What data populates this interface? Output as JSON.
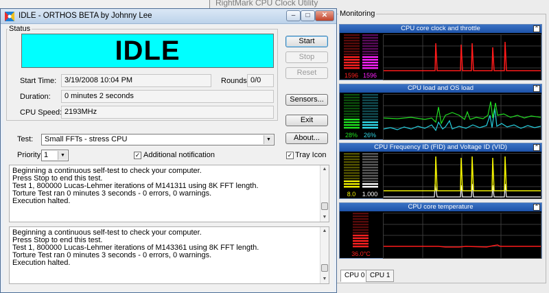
{
  "rightmark": {
    "title": "RightMark CPU Clock Utility",
    "monitoring_label": "Monitoring",
    "collapse_glyph": "⌃",
    "panels": [
      {
        "title": "CPU core clock and throttle",
        "readout_left": "1596",
        "readout_right": "1596",
        "color_left": "#ff2020",
        "color_right": "#ff20ff",
        "graph_color": "#ff1a1a",
        "level_left": 0.35,
        "level_right": 0.35
      },
      {
        "title": "CPU load and OS load",
        "readout_left": "28%",
        "readout_right": "26%",
        "color_left": "#20e020",
        "color_right": "#30d8e8",
        "graph_color": "#22dd22",
        "graph_color_2": "#26d0e0",
        "level_left": 0.28,
        "level_right": 0.26
      },
      {
        "title": "CPU Frequency ID (FID) and Voltage ID (VID)",
        "readout_left": "8.0",
        "readout_right": "1.000",
        "color_left": "#f2f200",
        "color_right": "#ffffff",
        "graph_color": "#f2f200",
        "graph_color_2": "#ffffff",
        "level_left": 0.2,
        "level_right": 0.12
      },
      {
        "title": "CPU core temperature",
        "readout_left": "36.0°C",
        "color_left": "#ff2020",
        "graph_color": "#ff1a1a",
        "level_left": 0.36
      }
    ],
    "tabs": [
      "CPU 0",
      "CPU 1"
    ]
  },
  "orthos": {
    "title": "IDLE - ORTHOS BETA by Johnny Lee",
    "window_buttons": {
      "minimize": "–",
      "maximize": "□",
      "close": "✕"
    },
    "status_label": "Status",
    "status_text": "IDLE",
    "status_color": "#00ffff",
    "fields": {
      "start_time_label": "Start Time:",
      "start_time_value": "3/19/2008 10:04 PM",
      "rounds_label": "Rounds:",
      "rounds_value": "0/0",
      "duration_label": "Duration:",
      "duration_value": "0 minutes 2 seconds",
      "cpu_speed_label": "CPU Speed:",
      "cpu_speed_value": "2193MHz"
    },
    "buttons": {
      "start": "Start",
      "stop": "Stop",
      "reset": "Reset",
      "sensors": "Sensors...",
      "exit": "Exit",
      "about": "About..."
    },
    "test_label": "Test:",
    "test_value": "Small FFTs - stress CPU",
    "priority_label": "Priority:",
    "priority_value": "1",
    "additional_notification_label": "Additional notification",
    "additional_notification_checked": true,
    "tray_icon_label": "Tray Icon",
    "tray_icon_checked": true,
    "check_glyph": "✓",
    "dropdown_glyph": "▼",
    "scroll_up_glyph": "▲",
    "scroll_down_glyph": "▼",
    "log1": [
      "Beginning a continuous self-test to check your computer.",
      "Press Stop to end this test.",
      "Test 1, 800000 Lucas-Lehmer iterations of M141311 using 8K FFT length.",
      "Torture Test ran 0 minutes 3 seconds - 0 errors, 0 warnings.",
      "Execution halted."
    ],
    "log2": [
      "Beginning a continuous self-test to check your computer.",
      "Press Stop to end this test.",
      "Test 1, 800000 Lucas-Lehmer iterations of M143361 using 8K FFT length.",
      "Torture Test ran 0 minutes 3 seconds - 0 errors, 0 warnings.",
      "Execution halted."
    ]
  }
}
